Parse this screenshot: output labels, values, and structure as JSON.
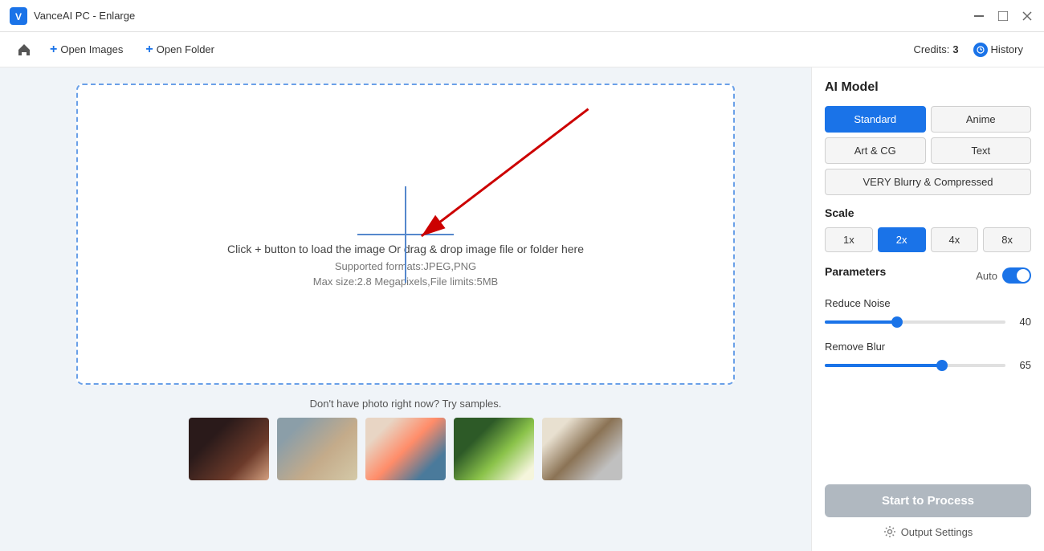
{
  "titlebar": {
    "title": "VanceAI PC - Enlarge",
    "logo_alt": "VanceAI logo"
  },
  "toolbar": {
    "open_images_label": "Open Images",
    "open_folder_label": "Open Folder",
    "credits_label": "Credits:",
    "credits_value": "3",
    "history_label": "History"
  },
  "dropzone": {
    "main_text": "Click + button to load the image Or drag & drop image file or folder here",
    "format_text": "Supported formats:JPEG,PNG",
    "size_text": "Max size:2.8 Megapixels,File limits:5MB"
  },
  "samples": {
    "label": "Don't have photo right now? Try samples."
  },
  "right_panel": {
    "ai_model_title": "AI Model",
    "models": [
      {
        "id": "standard",
        "label": "Standard",
        "active": true,
        "wide": false
      },
      {
        "id": "anime",
        "label": "Anime",
        "active": false,
        "wide": false
      },
      {
        "id": "art-cg",
        "label": "Art & CG",
        "active": false,
        "wide": false
      },
      {
        "id": "text",
        "label": "Text",
        "active": false,
        "wide": false
      },
      {
        "id": "very-blurry",
        "label": "VERY Blurry & Compressed",
        "active": false,
        "wide": true
      }
    ],
    "scale_title": "Scale",
    "scales": [
      {
        "label": "1x",
        "active": false
      },
      {
        "label": "2x",
        "active": true
      },
      {
        "label": "4x",
        "active": false
      },
      {
        "label": "8x",
        "active": false
      }
    ],
    "params_title": "Parameters",
    "auto_label": "Auto",
    "reduce_noise_label": "Reduce Noise",
    "reduce_noise_value": "40",
    "reduce_noise_pct": 40,
    "remove_blur_label": "Remove Blur",
    "remove_blur_value": "65",
    "remove_blur_pct": 65,
    "start_button_label": "Start to Process",
    "output_settings_label": "Output Settings"
  }
}
